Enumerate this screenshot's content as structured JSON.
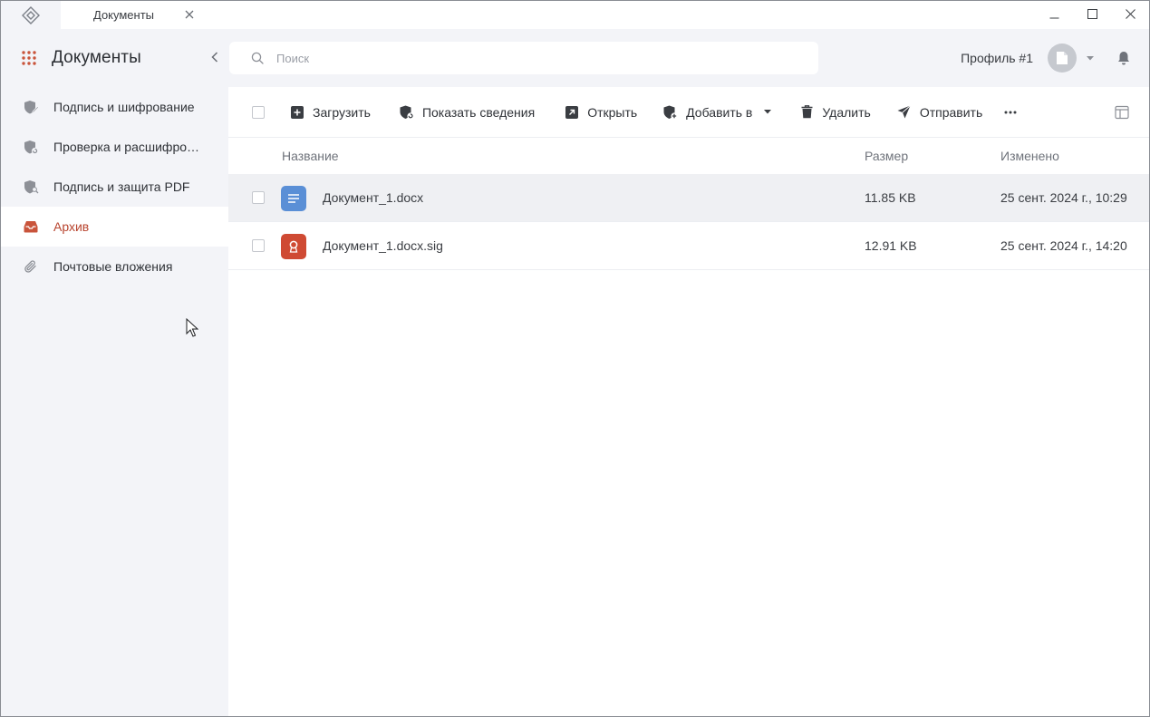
{
  "titlebar": {
    "tab_label": "Документы"
  },
  "sidebar": {
    "title": "Документы",
    "items": [
      {
        "label": "Подпись и шифрование",
        "icon": "shield-pen-icon",
        "active": false
      },
      {
        "label": "Проверка и расшифров…",
        "icon": "shield-check-icon",
        "active": false
      },
      {
        "label": "Подпись и защита PDF",
        "icon": "shield-pdf-icon",
        "active": false
      },
      {
        "label": "Архив",
        "icon": "inbox-icon",
        "active": true
      },
      {
        "label": "Почтовые вложения",
        "icon": "paperclip-icon",
        "active": false
      }
    ]
  },
  "search": {
    "placeholder": "Поиск",
    "value": ""
  },
  "profile": {
    "name": "Профиль #1"
  },
  "toolbar": {
    "upload": "Загрузить",
    "show_info": "Показать сведения",
    "open": "Открыть",
    "add_to": "Добавить в",
    "delete": "Удалить",
    "send": "Отправить"
  },
  "table": {
    "columns": {
      "name": "Название",
      "size": "Размер",
      "modified": "Изменено"
    },
    "rows": [
      {
        "name": "Документ_1.docx",
        "size": "11.85 KB",
        "modified": "25 сент. 2024 г., 10:29",
        "type": "document",
        "selected": true
      },
      {
        "name": "Документ_1.docx.sig",
        "size": "12.91 KB",
        "modified": "25 сент. 2024 г., 14:20",
        "type": "signature",
        "selected": false
      }
    ]
  },
  "colors": {
    "accent": "#b8442e",
    "doc_icon_bg": "#5a8fd6",
    "sig_icon_bg": "#cf4a33",
    "sidebar_bg": "#f3f4f8",
    "selected_row_bg": "#eff0f3"
  }
}
